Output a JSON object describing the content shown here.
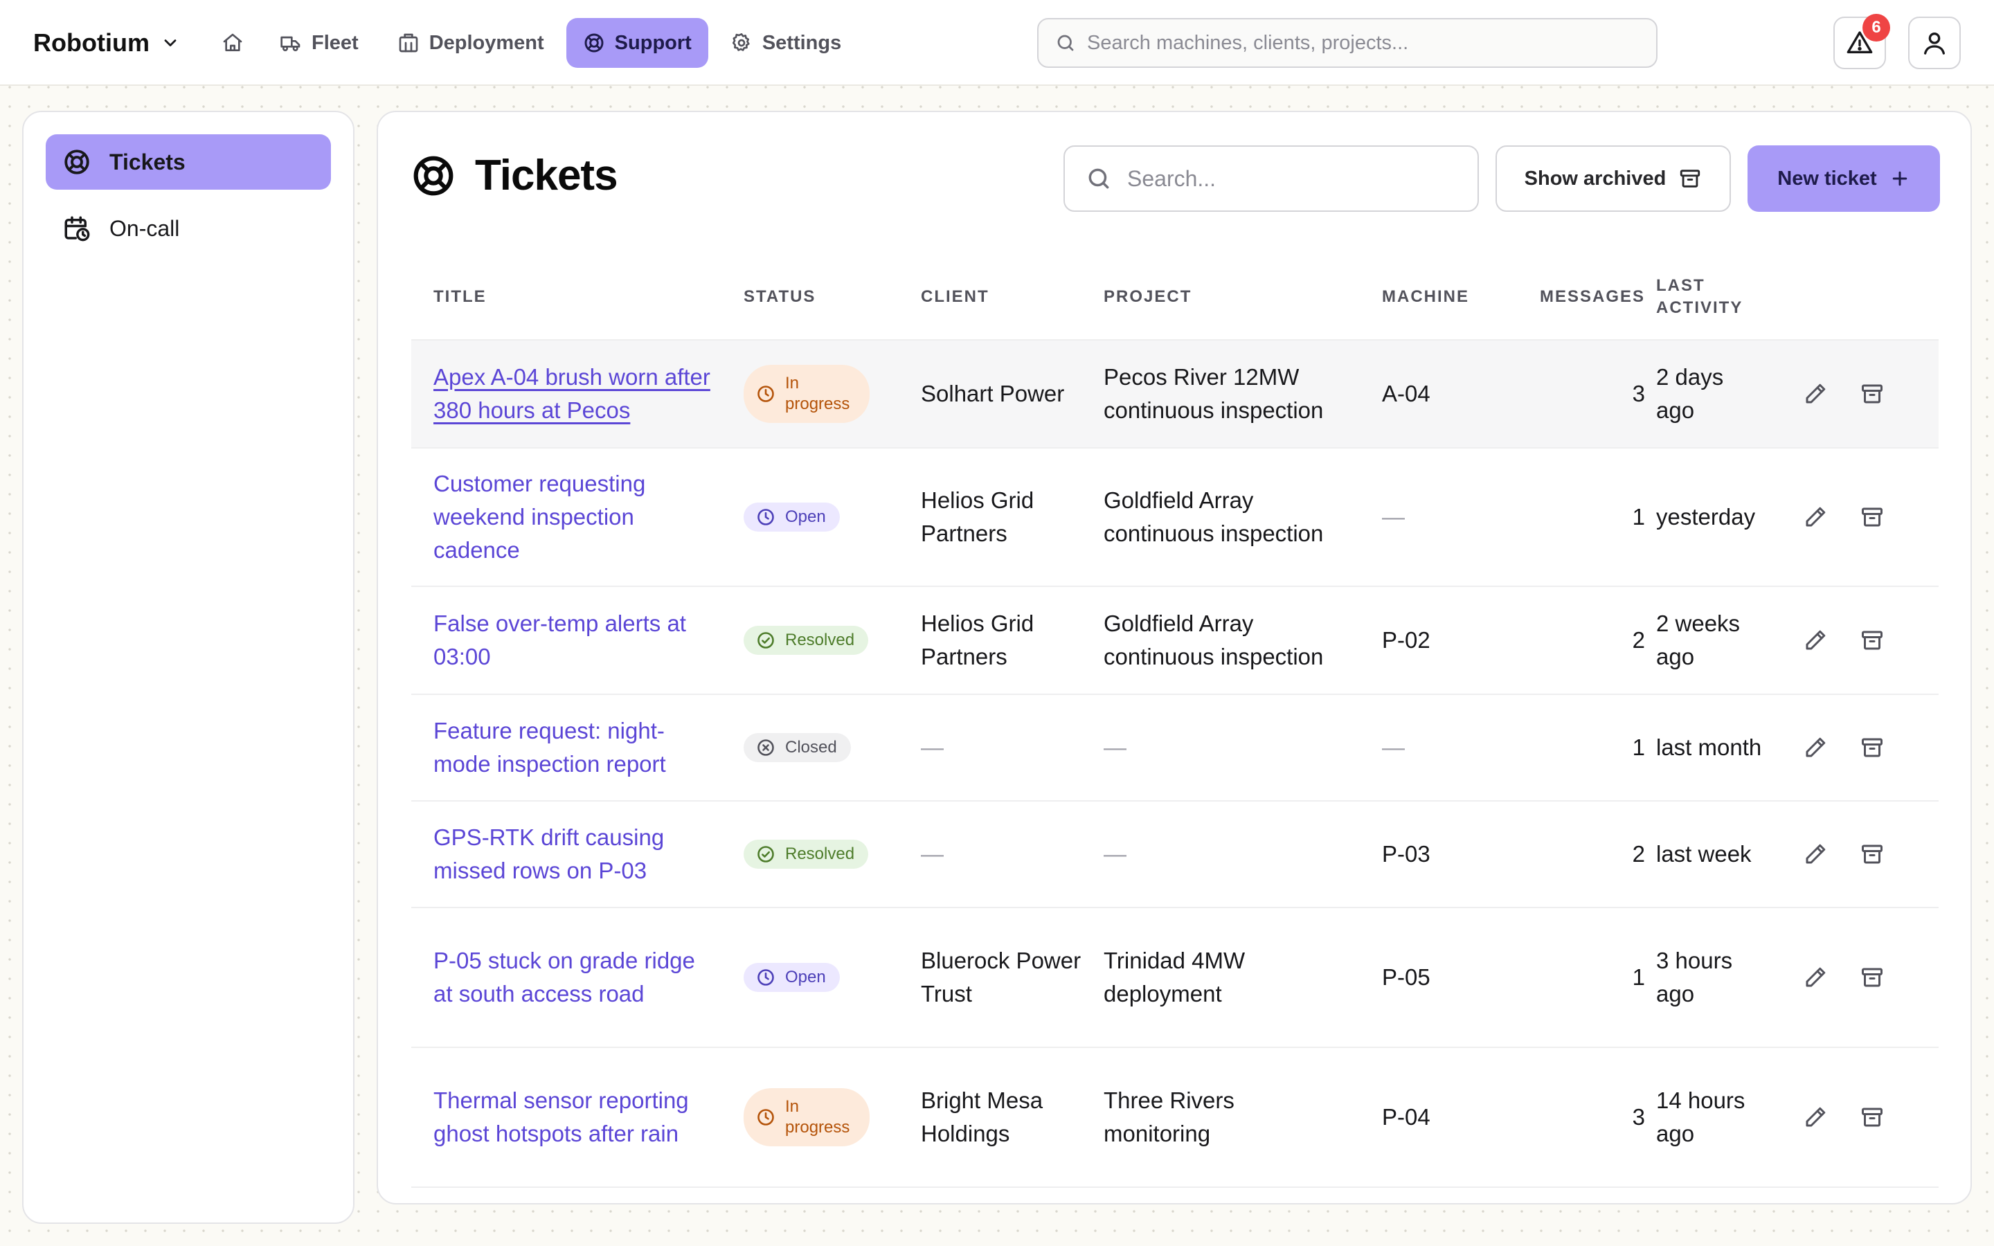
{
  "app": {
    "brand": "Robotium"
  },
  "nav": {
    "items": [
      {
        "label": "Fleet",
        "icon": "truck-icon"
      },
      {
        "label": "Deployment",
        "icon": "building-icon"
      },
      {
        "label": "Support",
        "icon": "lifebuoy-icon",
        "active": true
      },
      {
        "label": "Settings",
        "icon": "gear-icon"
      }
    ]
  },
  "top_search": {
    "placeholder": "Search machines, clients, projects..."
  },
  "alerts": {
    "count": "6"
  },
  "sidebar": {
    "items": [
      {
        "label": "Tickets",
        "icon": "lifebuoy-icon",
        "active": true
      },
      {
        "label": "On-call",
        "icon": "calendar-clock-icon"
      }
    ]
  },
  "page": {
    "title": "Tickets",
    "search_placeholder": "Search...",
    "show_archived_label": "Show archived",
    "new_ticket_label": "New ticket"
  },
  "table": {
    "headers": {
      "title": "TITLE",
      "status": "STATUS",
      "client": "CLIENT",
      "project": "PROJECT",
      "machine": "MACHINE",
      "messages": "MESSAGES",
      "last_activity": "LAST ACTIVITY"
    },
    "rows": [
      {
        "title": "Apex A-04 brush worn after 380 hours at Pecos",
        "status": "In progress",
        "client": "Solhart Power",
        "project": "Pecos River 12MW continuous inspection",
        "machine": "A-04",
        "messages": "3",
        "last_activity": "2 days ago"
      },
      {
        "title": "Customer requesting weekend inspection cadence",
        "status": "Open",
        "client": "Helios Grid Partners",
        "project": "Goldfield Array continuous inspection",
        "machine": "—",
        "messages": "1",
        "last_activity": "yesterday"
      },
      {
        "title": "False over-temp alerts at 03:00",
        "status": "Resolved",
        "client": "Helios Grid Partners",
        "project": "Goldfield Array continuous inspection",
        "machine": "P-02",
        "messages": "2",
        "last_activity": "2 weeks ago"
      },
      {
        "title": "Feature request: night-mode inspection report",
        "status": "Closed",
        "client": "—",
        "project": "—",
        "machine": "—",
        "messages": "1",
        "last_activity": "last month"
      },
      {
        "title": "GPS-RTK drift causing missed rows on P-03",
        "status": "Resolved",
        "client": "—",
        "project": "—",
        "machine": "P-03",
        "messages": "2",
        "last_activity": "last week"
      },
      {
        "title": "P-05 stuck on grade ridge at south access road",
        "status": "Open",
        "client": "Bluerock Power Trust",
        "project": "Trinidad 4MW deployment",
        "machine": "P-05",
        "messages": "1",
        "last_activity": "3 hours ago"
      },
      {
        "title": "Thermal sensor reporting ghost hotspots after rain",
        "status": "In progress",
        "client": "Bright Mesa Holdings",
        "project": "Three Rivers monitoring",
        "machine": "P-04",
        "messages": "3",
        "last_activity": "14 hours ago"
      }
    ]
  },
  "colors": {
    "accent": "#a89af7",
    "link": "#5b46d6",
    "alert_badge": "#ef4444",
    "status_in_progress": "#b45309",
    "status_open": "#4c3fb8",
    "status_resolved": "#4d7c2a",
    "status_closed": "#52525b"
  }
}
